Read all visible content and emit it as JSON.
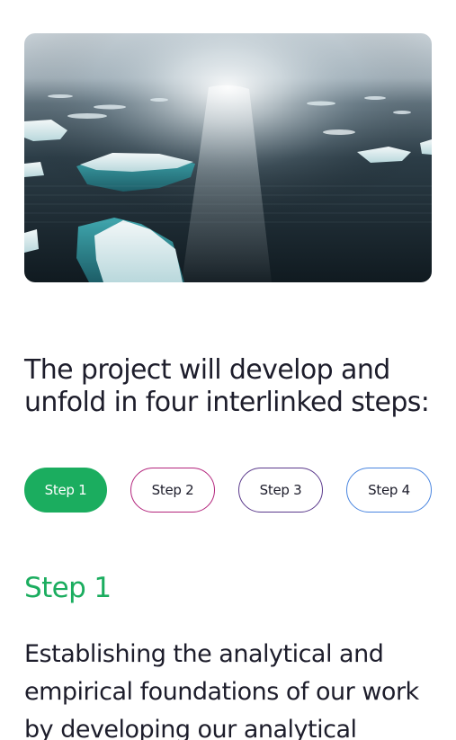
{
  "hero": {
    "image_description": "aerial-sea-ice-photo"
  },
  "headline": {
    "line1": "The project will develop and",
    "line2": "unfold in four interlinked steps:"
  },
  "tabs": [
    {
      "label": "Step 1",
      "active": true,
      "border_color": "#1bad5f"
    },
    {
      "label": "Step 2",
      "active": false,
      "border_color": "#b3247c"
    },
    {
      "label": "Step 3",
      "active": false,
      "border_color": "#5b3a8c"
    },
    {
      "label": "Step 4",
      "active": false,
      "border_color": "#4a86e0"
    }
  ],
  "step": {
    "title": "Step 1",
    "title_color": "#1bad5f",
    "description": "Establishing the analytical and empirical foundations of our work by developing our analytical"
  },
  "colors": {
    "accent": "#1bad5f",
    "text": "#1d1d2b"
  }
}
